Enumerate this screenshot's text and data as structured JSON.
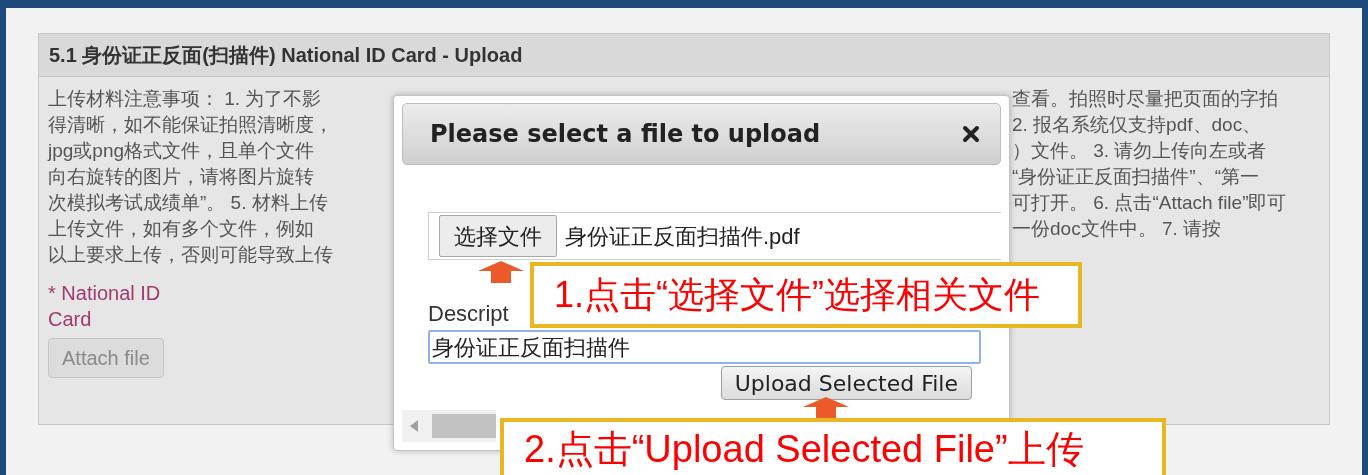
{
  "panel": {
    "title": "5.1 身份证正反面(扫描件) National ID Card - Upload",
    "notes_left": [
      "上传材料注意事项： 1. 为了不影",
      "得清晰，如不能保证拍照清晰度，",
      "jpg或png格式文件，且单个文件",
      "向右旋转的图片，请将图片旋转",
      "次模拟考试成绩单”。 5. 材料上传",
      "上传文件，如有多个文件，例如",
      "以上要求上传，否则可能导致上传"
    ],
    "notes_right": [
      "查看。拍照时尽量把页面的字拍",
      "2. 报名系统仅支持pdf、doc、",
      "）文件。 3. 请勿上传向左或者",
      "“身份证正反面扫描件”、“第一",
      "可打开。 6. 点击“Attach file”即可",
      "一份doc文件中。 7. 请按"
    ],
    "field_label": "* National ID Card",
    "attach_button": {
      "label": "Attach file",
      "disabled": true
    }
  },
  "dialog": {
    "title": "Please select a file to upload",
    "choose_button": "选择文件",
    "file_name": "身份证正反面扫描件.pdf",
    "description_label": "Descript",
    "description_value": "身份证正反面扫描件",
    "upload_button": "Upload Selected File"
  },
  "callouts": [
    {
      "text": "1.点击“选择文件”选择相关文件"
    },
    {
      "text": "2.点击“Upload Selected File”上传"
    }
  ]
}
